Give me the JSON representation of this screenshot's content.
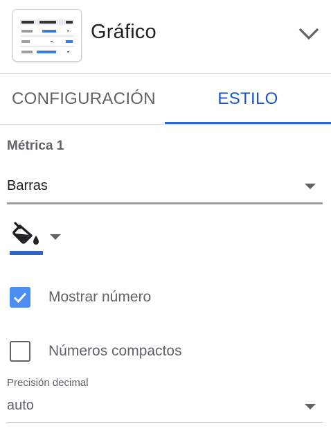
{
  "header": {
    "title": "Gráfico",
    "thumbnail_icon": "table-chart-icon",
    "expand_icon": "chevron-down-icon"
  },
  "tabs": [
    {
      "label": "CONFIGURACIÓN",
      "active": false
    },
    {
      "label": "ESTILO",
      "active": true
    }
  ],
  "metric": {
    "section_title": "Métrica 1",
    "display_type": "Barras",
    "color_icon": "paint-bucket-icon",
    "color": "#2c66c2"
  },
  "options": {
    "show_number_label": "Mostrar número",
    "show_number_checked": true,
    "compact_numbers_label": "Números compactos",
    "compact_numbers_checked": false
  },
  "precision": {
    "label": "Precisión decimal",
    "value": "auto"
  },
  "colors": {
    "accent": "#1a55c4",
    "checkbox": "#4d8ef2"
  }
}
